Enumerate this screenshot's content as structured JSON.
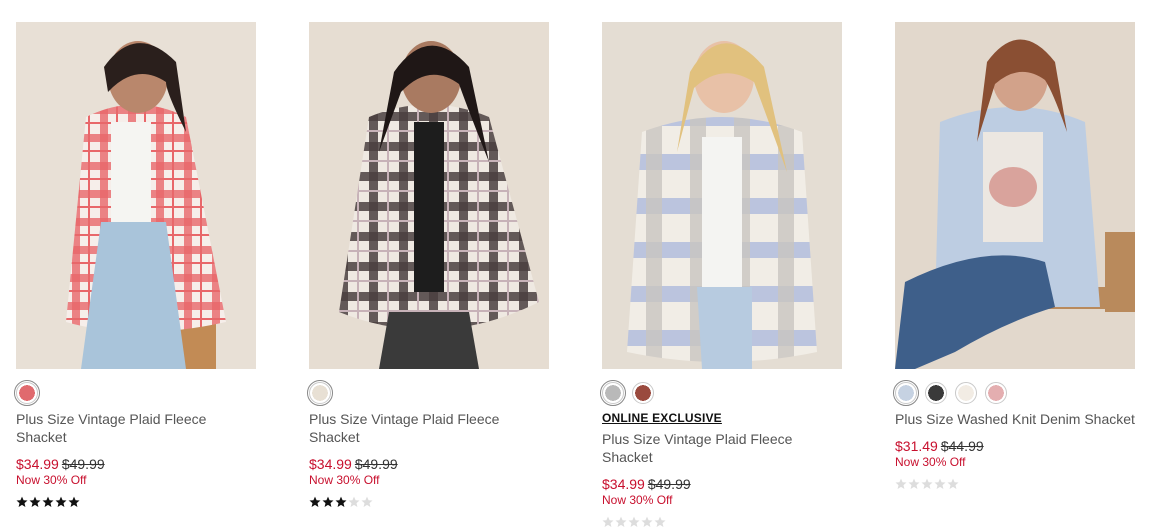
{
  "products": [
    {
      "image_alt": "Plus Size Vintage Plaid Fleece Shacket red plaid",
      "swatches": [
        {
          "name": "red plaid",
          "color": "#e06a6e"
        }
      ],
      "badge": "",
      "title": "Plus Size Vintage Plaid Fleece Shacket",
      "sale_price": "$34.99",
      "original_price": "$49.99",
      "promo": "Now 30% Off",
      "rating": 5
    },
    {
      "image_alt": "Plus Size Vintage Plaid Fleece Shacket black plaid",
      "swatches": [
        {
          "name": "ivory black plaid",
          "color": "#e8e0d4"
        }
      ],
      "badge": "",
      "title": "Plus Size Vintage Plaid Fleece Shacket",
      "sale_price": "$34.99",
      "original_price": "$49.99",
      "promo": "Now 30% Off",
      "rating": 3
    },
    {
      "image_alt": "Plus Size Vintage Plaid Fleece Shacket blue plaid",
      "swatches": [
        {
          "name": "gray plaid",
          "color": "#b9b9b9"
        },
        {
          "name": "brown plaid",
          "color": "#9a4a3e"
        }
      ],
      "badge": "ONLINE EXCLUSIVE",
      "title": "Plus Size Vintage Plaid Fleece Shacket",
      "sale_price": "$34.99",
      "original_price": "$49.99",
      "promo": "Now 30% Off",
      "rating": 0
    },
    {
      "image_alt": "Plus Size Washed Knit Denim Shacket light blue",
      "swatches": [
        {
          "name": "light blue",
          "color": "#c6d2e2"
        },
        {
          "name": "black",
          "color": "#3a3a3a"
        },
        {
          "name": "ivory",
          "color": "#f2ece4"
        },
        {
          "name": "pink",
          "color": "#e4aeb0"
        }
      ],
      "badge": "",
      "title": "Plus Size Washed Knit Denim Shacket",
      "sale_price": "$31.49",
      "original_price": "$44.99",
      "promo": "Now 30% Off",
      "rating": 0
    }
  ],
  "colors": {
    "sale": "#c8102e",
    "star_filled": "#111111",
    "star_empty": "#dddddd",
    "photo_bg": "#e9e2d8"
  }
}
